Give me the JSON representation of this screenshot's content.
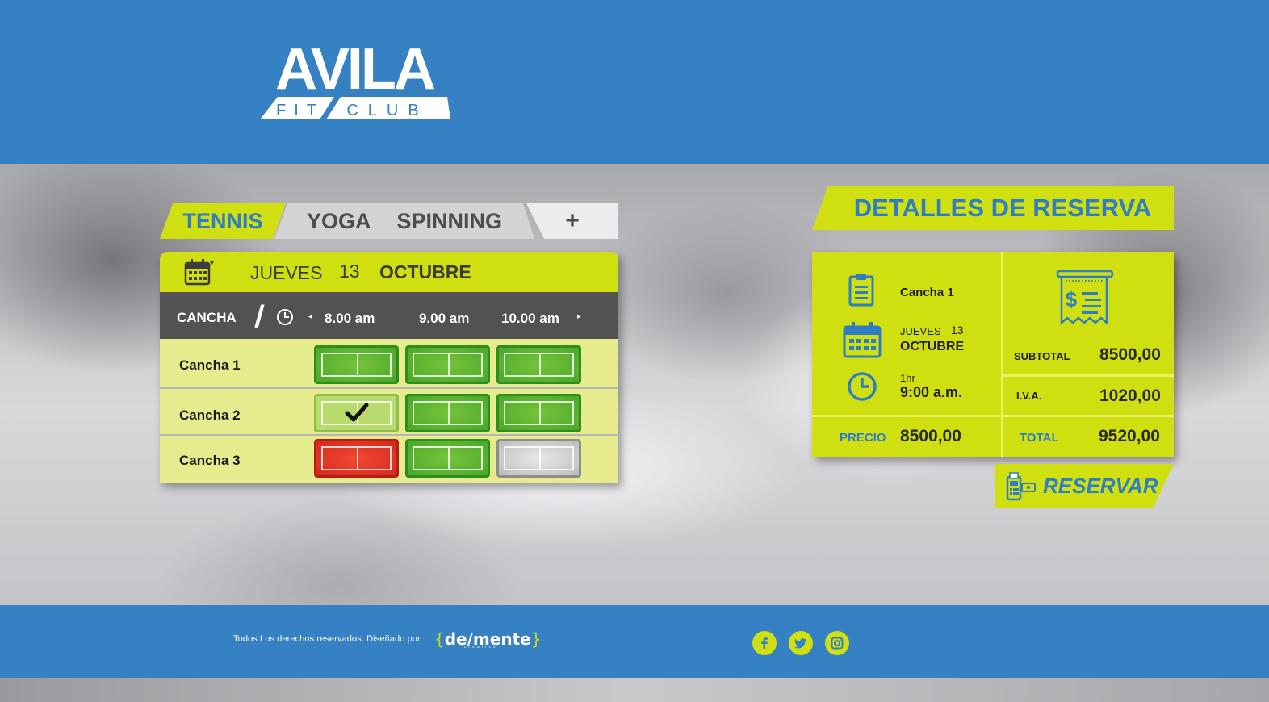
{
  "logo": {
    "main": "AVILA",
    "sub_left": "FIT",
    "sub_right": "CLUB"
  },
  "tabs": {
    "active": "TENNIS",
    "items": [
      "YOGA",
      "SPINNING"
    ],
    "add": "+"
  },
  "date": {
    "day": "JUEVES",
    "number": "13",
    "month": "OCTUBRE"
  },
  "schedule": {
    "cancha_header": "CANCHA",
    "slash": "/",
    "prev_arrow": "◂",
    "next_arrow": "▸",
    "times": [
      "8.00 am",
      "9.00 am",
      "10.00 am"
    ],
    "rows": [
      {
        "label": "Cancha 1",
        "status": [
          "available",
          "available",
          "available"
        ]
      },
      {
        "label": "Cancha 2",
        "status": [
          "selected",
          "available",
          "available"
        ]
      },
      {
        "label": "Cancha 3",
        "status": [
          "taken",
          "available",
          "disabled"
        ]
      }
    ]
  },
  "details": {
    "title": "DETALLES DE RESERVA",
    "court": "Cancha 1",
    "day": "JUEVES",
    "day_number": "13",
    "month": "OCTUBRE",
    "duration": "1hr",
    "time": "9:00 a.m.",
    "precio_label": "PRECIO",
    "precio": "8500,00",
    "subtotal_label": "SUBTOTAL",
    "subtotal": "8500,00",
    "iva_label": "I.V.A.",
    "iva": "1020,00",
    "total_label": "TOTAL",
    "total": "9520,00"
  },
  "reserve_button": "RESERVAR",
  "footer": {
    "copyright": "Todos Los derechos reservados. Diseñado por",
    "brand_open": "{",
    "brand": "de/mente",
    "brand_close": "}",
    "brand_sub": "creativo"
  },
  "colors": {
    "blue": "#3680c4",
    "lime": "#cfdf10",
    "green": "#4aa82a",
    "red": "#d6281c",
    "grey": "#525252"
  },
  "icons": [
    "calendar-icon",
    "clock-icon",
    "clipboard-icon",
    "receipt-icon",
    "pos-terminal-icon",
    "facebook-icon",
    "twitter-icon",
    "instagram-icon",
    "checkmark-icon"
  ]
}
